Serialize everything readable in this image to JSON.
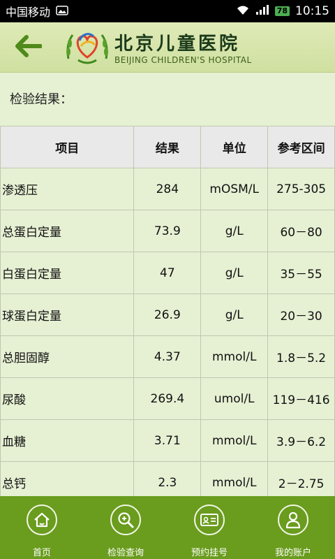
{
  "status_bar": {
    "carrier": "中国移动",
    "battery": "78",
    "time": "10:15"
  },
  "header": {
    "hospital_name_cn": "北京儿童医院",
    "hospital_name_en": "BEIJING CHILDREN'S HOSPITAL"
  },
  "page": {
    "section_title": "检验结果："
  },
  "table": {
    "headers": [
      "项目",
      "结果",
      "单位",
      "参考区间"
    ],
    "rows": [
      {
        "item": "渗透压",
        "result": "284",
        "unit": "mOSM/L",
        "range": "275-305"
      },
      {
        "item": "总蛋白定量",
        "result": "73.9",
        "unit": "g/L",
        "range": "60－80"
      },
      {
        "item": "白蛋白定量",
        "result": "47",
        "unit": "g/L",
        "range": "35－55"
      },
      {
        "item": "球蛋白定量",
        "result": "26.9",
        "unit": "g/L",
        "range": "20－30"
      },
      {
        "item": "总胆固醇",
        "result": "4.37",
        "unit": "mmol/L",
        "range": "1.8－5.2"
      },
      {
        "item": "尿酸",
        "result": "269.4",
        "unit": "umol/L",
        "range": "119－416"
      },
      {
        "item": "血糖",
        "result": "3.71",
        "unit": "mmol/L",
        "range": "3.9－6.2"
      },
      {
        "item": "总钙",
        "result": "2.3",
        "unit": "mmol/L",
        "range": "2－2.75"
      }
    ]
  },
  "tabbar": {
    "tabs": [
      {
        "label": "首页",
        "icon": "home-icon"
      },
      {
        "label": "检验查询",
        "icon": "search-icon"
      },
      {
        "label": "预约挂号",
        "icon": "id-card-icon"
      },
      {
        "label": "我的账户",
        "icon": "user-icon"
      }
    ]
  },
  "colors": {
    "background": "#e6f0d3",
    "header": "#cfe0a0",
    "accent": "#5a8f1e",
    "tabbar": "#6a9c1e"
  }
}
